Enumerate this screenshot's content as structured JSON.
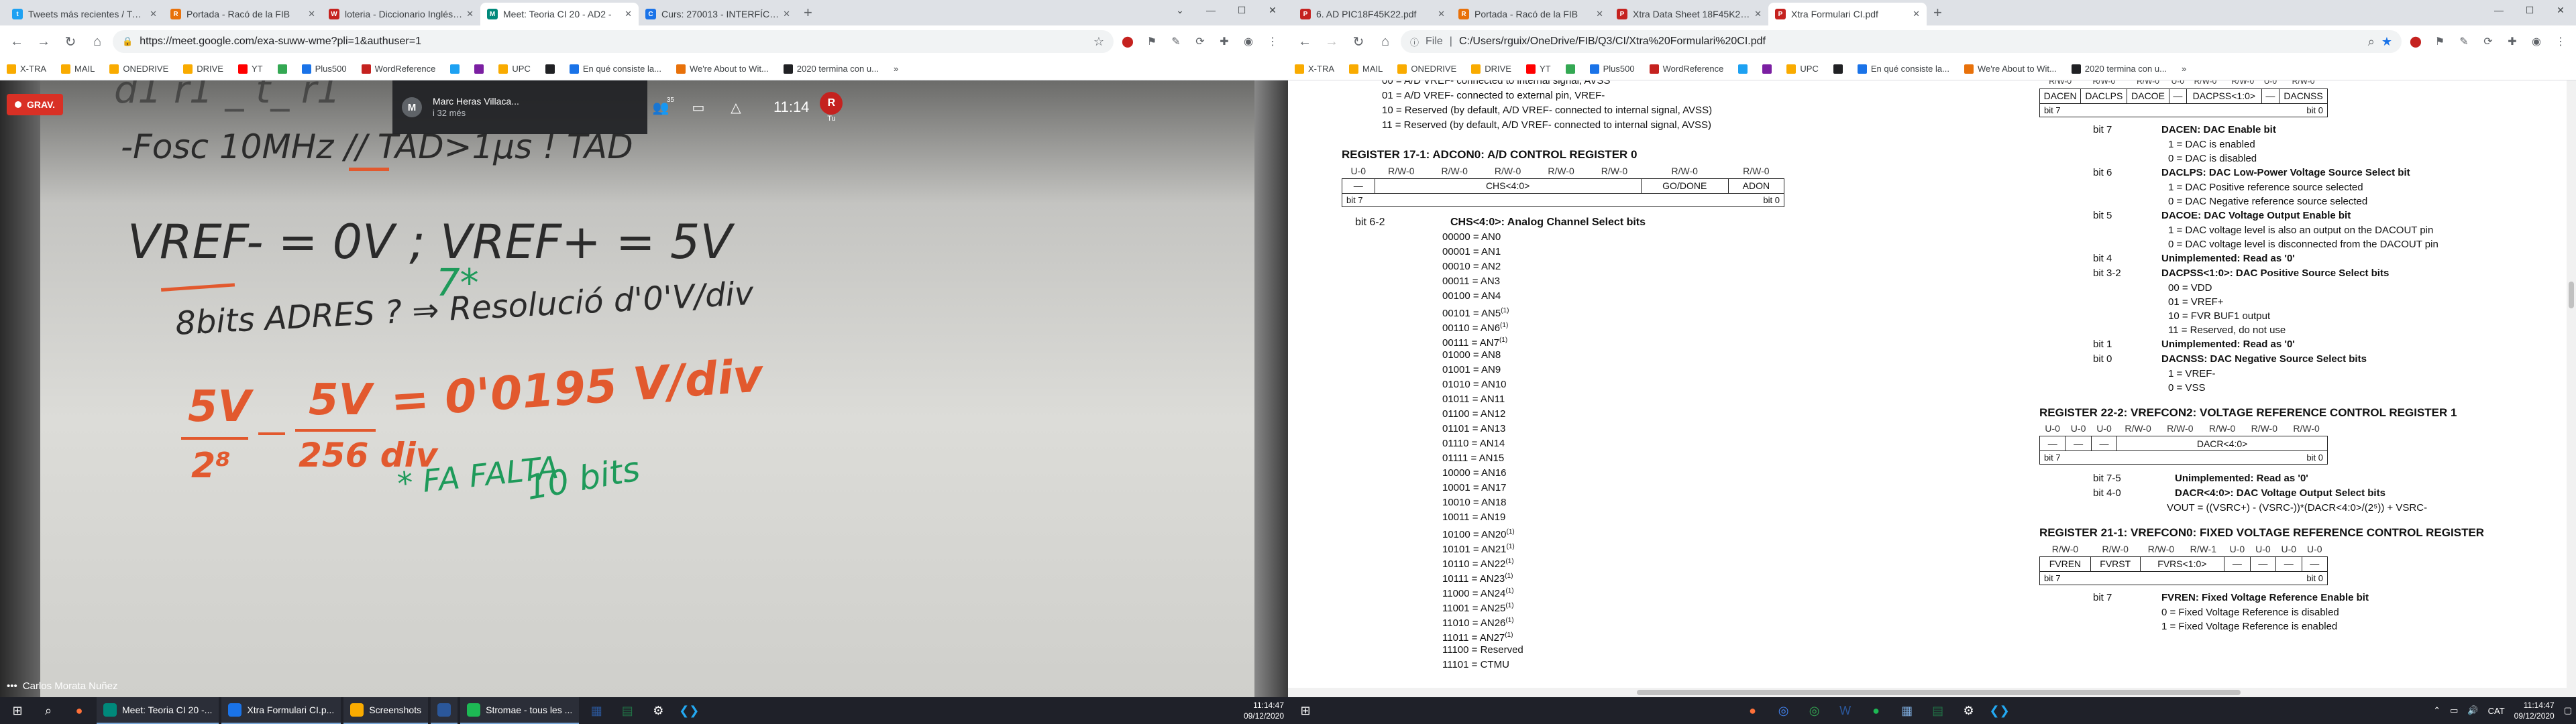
{
  "left": {
    "tabs": [
      {
        "title": "Tweets más recientes / Twitter",
        "color": "#1da1f2",
        "glyph": "t"
      },
      {
        "title": "Portada - Racó de la FIB",
        "color": "#e8710a",
        "glyph": "R"
      },
      {
        "title": "loteria - Diccionario Inglés-Esp...",
        "color": "#c5221f",
        "glyph": "W"
      },
      {
        "title": "Meet: Teoria CI 20 - AD2 -",
        "color": "#00897b",
        "glyph": "M",
        "active": true
      },
      {
        "title": "Curs: 270013 - INTERFÍCIES DE C...",
        "color": "#1a73e8",
        "glyph": "C"
      }
    ],
    "url": "https://meet.google.com/exa-suww-wme?pli=1&authuser=1",
    "bookmarks": [
      "X-TRA",
      "MAIL",
      "ONEDRIVE",
      "DRIVE",
      "YT",
      "",
      "Plus500",
      "WordReference",
      "",
      "",
      "UPC",
      "",
      "En qué consiste la...",
      "We're About to Wit...",
      "2020 termina con u..."
    ],
    "meet": {
      "rec_label": "GRAV.",
      "presenter_avatar": "M",
      "presenter_name": "Marc Heras Villaca...",
      "presenter_sub": "i 32 més",
      "participants_count": "35",
      "time": "11:14",
      "you_initial": "R",
      "you_label": "Tu",
      "notif_count": "3",
      "speaker_name": "Carlos Morata Nuñez",
      "board": {
        "l1": "-Fosc 10MHz  // TAD>1µs ! TAD",
        "l2": "VREF- = 0V  ;  VREF+ = 5V",
        "l3": "8bits ADRES ? ⇒ Resolució d'0'V/div",
        "l4a": "5V",
        "l4b": "2⁸",
        "l4c": "5V",
        "l4d": "256 div",
        "l4e": "= 0'0195 V/div",
        "star": "7*",
        "l5": "* FA FALTA",
        "l6": "10 bits"
      }
    },
    "taskbar": {
      "apps": [
        {
          "label": "Meet: Teoria CI 20 -...",
          "color": "#00897b"
        },
        {
          "label": "Xtra Formulari CI.p...",
          "color": "#1a73e8"
        },
        {
          "label": "Screenshots",
          "color": "#f9ab00"
        },
        {
          "label": "",
          "color": "#2b579a"
        },
        {
          "label": "Stromae - tous les ...",
          "color": "#1db954"
        }
      ],
      "time": "11:14:47",
      "date": "09/12/2020"
    }
  },
  "right": {
    "tabs": [
      {
        "title": "6. AD PIC18F45K22.pdf",
        "color": "#c5221f",
        "glyph": "P"
      },
      {
        "title": "Portada - Racó de la FIB",
        "color": "#e8710a",
        "glyph": "R"
      },
      {
        "title": "Xtra Data Sheet 18F45K22.pdf",
        "color": "#c5221f",
        "glyph": "P"
      },
      {
        "title": "Xtra Formulari CI.pdf",
        "color": "#c5221f",
        "glyph": "P",
        "active": true
      }
    ],
    "url_prefix": "File",
    "url": "C:/Users/rguix/OneDrive/FIB/Q3/CI/Xtra%20Formulari%20CI.pdf",
    "bookmarks": [
      "X-TRA",
      "MAIL",
      "ONEDRIVE",
      "DRIVE",
      "YT",
      "",
      "Plus500",
      "WordReference",
      "",
      "",
      "UPC",
      "",
      "En qué consiste la...",
      "We're About to Wit...",
      "2020 termina con u..."
    ],
    "pdf": {
      "top_lines": [
        "00 = A/D VREF- connected to internal signal, AVSS",
        "01 = A/D VREF- connected to external pin, VREF-",
        "10 = Reserved (by default, A/D VREF- connected to internal signal, AVSS)",
        "11 = Reserved (by default, A/D VREF- connected to internal signal, AVSS)"
      ],
      "reg17_title": "REGISTER 17-1:     ADCON0: A/D CONTROL REGISTER 0",
      "reg17_access": [
        "U-0",
        "R/W-0",
        "R/W-0",
        "R/W-0",
        "R/W-0",
        "R/W-0",
        "R/W-0",
        "R/W-0"
      ],
      "reg17_fields": [
        "—",
        "CHS<4:0>",
        "GO/DONE",
        "ADON"
      ],
      "bit7": "bit 7",
      "bit0": "bit 0",
      "chs_bit": "bit 6-2",
      "chs_desc": "CHS<4:0>: Analog Channel Select bits",
      "chs_list": [
        "00000 = AN0",
        "00001 = AN1",
        "00010 = AN2",
        "00011 = AN3",
        "00100 = AN4",
        "00101 = AN5(1)",
        "00110 = AN6(1)",
        "00111 = AN7(1)",
        "01000 = AN8",
        "01001 = AN9",
        "01010 = AN10",
        "01011 = AN11",
        "01100 = AN12",
        "01101 = AN13",
        "01110 = AN14",
        "01111 = AN15",
        "10000 = AN16",
        "10001 = AN17",
        "10010 = AN18",
        "10011 = AN19",
        "10100 = AN20(1)",
        "10101 = AN21(1)",
        "10110 = AN22(1)",
        "10111 = AN23(1)",
        "11000 = AN24(1)",
        "11001 = AN25(1)",
        "11010 = AN26(1)",
        "11011 = AN27(1)",
        "11100 = Reserved",
        "11101 = CTMU"
      ],
      "vref1_access": [
        "R/W-0",
        "R/W-0",
        "R/W-0",
        "U-0",
        "R/W-0",
        "R/W-0",
        "U-0",
        "R/W-0"
      ],
      "vref1_fields": [
        "DACEN",
        "DACLPS",
        "DACOE",
        "—",
        "DACPSS<1:0>",
        "—",
        "DACNSS"
      ],
      "vref1_bits": [
        {
          "bit": "bit 7",
          "desc": "DACEN: DAC Enable bit",
          "subs": [
            "1 = DAC is enabled",
            "0 = DAC is disabled"
          ]
        },
        {
          "bit": "bit 6",
          "desc": "DACLPS: DAC Low-Power Voltage Source Select bit",
          "subs": [
            "1 = DAC Positive reference source selected",
            "0 = DAC Negative reference source selected"
          ]
        },
        {
          "bit": "bit 5",
          "desc": "DACOE: DAC Voltage Output Enable bit",
          "subs": [
            "1 = DAC voltage level is also an output on the DACOUT pin",
            "0 = DAC voltage level is disconnected from the DACOUT pin"
          ]
        },
        {
          "bit": "bit 4",
          "desc": "Unimplemented: Read as '0'",
          "subs": []
        },
        {
          "bit": "bit 3-2",
          "desc": "DACPSS<1:0>: DAC Positive Source Select bits",
          "subs": [
            "00 = VDD",
            "01 = VREF+",
            "10 = FVR BUF1 output",
            "11 = Reserved, do not use"
          ]
        },
        {
          "bit": "bit 1",
          "desc": "Unimplemented: Read as '0'",
          "subs": []
        },
        {
          "bit": "bit 0",
          "desc": "DACNSS: DAC Negative Source Select bits",
          "subs": [
            "1 = VREF-",
            "0 = VSS"
          ]
        }
      ],
      "reg22_title": "REGISTER 22-2:     VREFCON2: VOLTAGE REFERENCE CONTROL REGISTER 1",
      "reg22_access": [
        "U-0",
        "U-0",
        "U-0",
        "R/W-0",
        "R/W-0",
        "R/W-0",
        "R/W-0",
        "R/W-0"
      ],
      "reg22_fields": [
        "—",
        "—",
        "—",
        "DACR<4:0>"
      ],
      "reg22_bits": [
        {
          "bit": "bit 7-5",
          "desc": "Unimplemented: Read as '0'"
        },
        {
          "bit": "bit 4-0",
          "desc": "DACR<4:0>: DAC Voltage Output Select bits"
        }
      ],
      "reg22_formula": "VOUT = ((VSRC+) - (VSRC-))*(DACR<4:0>/(2⁵)) + VSRC-",
      "reg21_title": "REGISTER 21-1:     VREFCON0: FIXED VOLTAGE REFERENCE CONTROL REGISTER",
      "reg21_access": [
        "R/W-0",
        "R/W-0",
        "R/W-0",
        "R/W-1",
        "U-0",
        "U-0",
        "U-0",
        "U-0"
      ],
      "reg21_fields": [
        "FVREN",
        "FVRST",
        "FVRS<1:0>",
        "—",
        "—",
        "—",
        "—"
      ],
      "reg21_bit": "bit 7",
      "reg21_desc": "FVREN: Fixed Voltage Reference Enable bit",
      "reg21_subs": [
        "0 = Fixed Voltage Reference is disabled",
        "1 = Fixed Voltage Reference is enabled"
      ]
    },
    "taskbar": {
      "lang": "CAT",
      "time": "11:14:47",
      "date": "09/12/2020"
    }
  }
}
